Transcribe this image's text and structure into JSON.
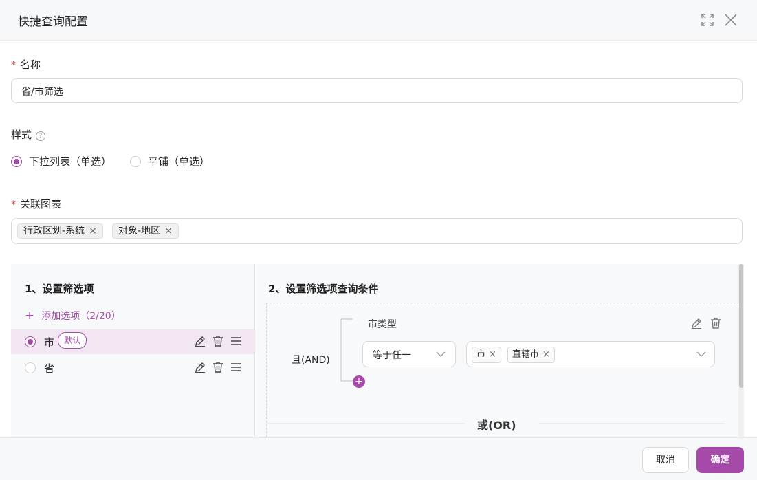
{
  "dialog": {
    "title": "快捷查询配置",
    "icons": {
      "fullscreen": "fullscreen-icon",
      "close": "close-icon"
    }
  },
  "form": {
    "name": {
      "required_mark": "*",
      "label": "名称",
      "value": "省/市筛选"
    },
    "style": {
      "label": "样式",
      "help_icon": "question-circle-icon",
      "help_glyph": "?",
      "options": [
        {
          "label": "下拉列表（单选）",
          "selected": true
        },
        {
          "label": "平铺（单选）",
          "selected": false
        }
      ]
    },
    "linked_charts": {
      "required_mark": "*",
      "label": "关联图表",
      "tags": [
        "行政区划-系统",
        "对象-地区"
      ],
      "remove_glyph": "×"
    }
  },
  "filter_items": {
    "title": "1、设置筛选项",
    "add_icon": "+",
    "add_label": "添加选项（2/20）",
    "items": [
      {
        "label": "市",
        "badge": "默认",
        "selected": true
      },
      {
        "label": "省",
        "badge": "",
        "selected": false
      }
    ]
  },
  "conditions": {
    "title": "2、设置筛选项查询条件",
    "logic_label": "且(AND)",
    "add_glyph": "+",
    "field_label": "市类型",
    "operator": "等于任一",
    "values": [
      "市",
      "直辖市"
    ],
    "remove_glyph": "×",
    "or_label": "或(OR)"
  },
  "footer": {
    "cancel_label": "取消",
    "ok_label": "确定"
  },
  "colors": {
    "accent": "#a54aa8",
    "required": "#e5484d"
  }
}
